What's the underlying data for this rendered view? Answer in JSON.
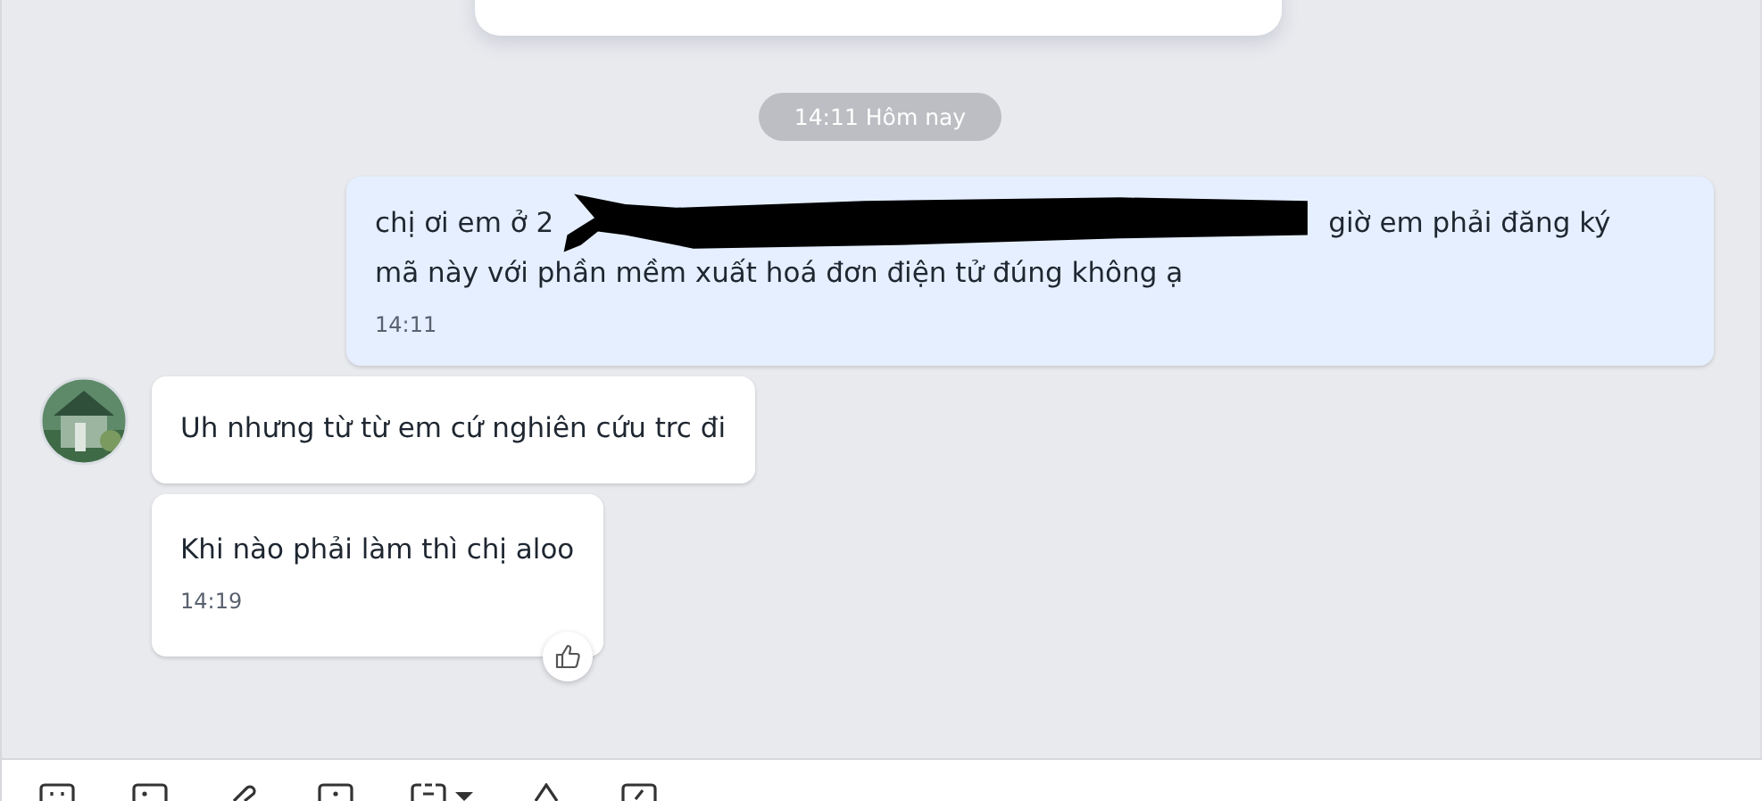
{
  "date_divider": "14:11 Hôm nay",
  "messages": [
    {
      "kind": "outgoing",
      "redacted": true,
      "parts": [
        "chị ơi em ở 2",
        "giờ em phải đăng ký",
        "mã này với phần mềm xuất hoá đơn điện tử đúng không ạ"
      ],
      "time": "14:11"
    },
    {
      "kind": "incoming",
      "avatar": true,
      "text": "Uh nhưng từ từ em cứ nghiên cứu trc đi"
    },
    {
      "kind": "incoming",
      "avatar": false,
      "text": "Khi nào phải làm thì chị aloo",
      "time": "14:19",
      "liked": true
    }
  ]
}
